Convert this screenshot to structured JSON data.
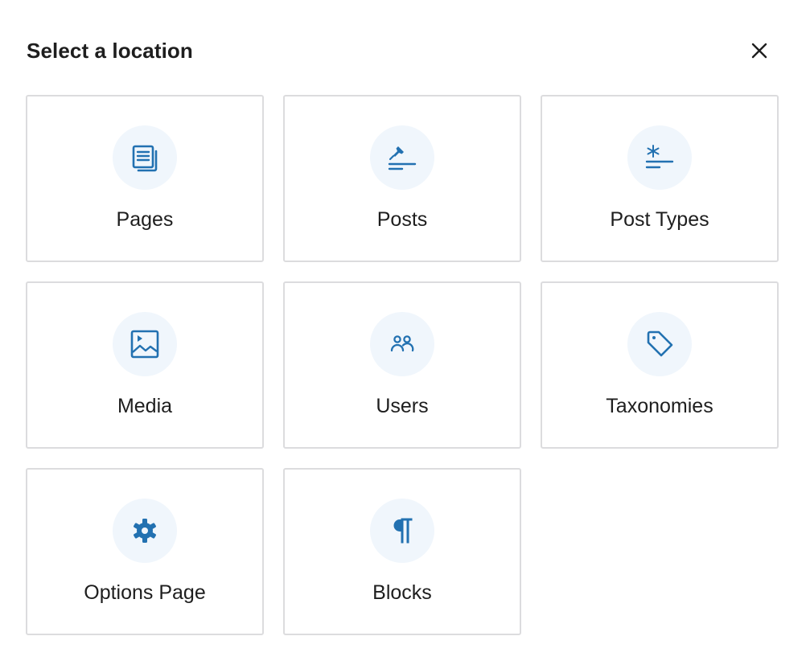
{
  "modal": {
    "title": "Select a location",
    "close_icon": "close-icon"
  },
  "colors": {
    "icon_blue": "#2271b1",
    "icon_bg": "#f0f6fc",
    "card_border": "#dcdcde",
    "text": "#1e1e1e"
  },
  "locations": [
    {
      "label": "Pages",
      "icon": "pages-icon"
    },
    {
      "label": "Posts",
      "icon": "pushpin-icon"
    },
    {
      "label": "Post Types",
      "icon": "post-types-icon"
    },
    {
      "label": "Media",
      "icon": "media-icon"
    },
    {
      "label": "Users",
      "icon": "users-icon"
    },
    {
      "label": "Taxonomies",
      "icon": "tag-icon"
    },
    {
      "label": "Options Page",
      "icon": "gear-icon"
    },
    {
      "label": "Blocks",
      "icon": "paragraph-icon"
    }
  ]
}
